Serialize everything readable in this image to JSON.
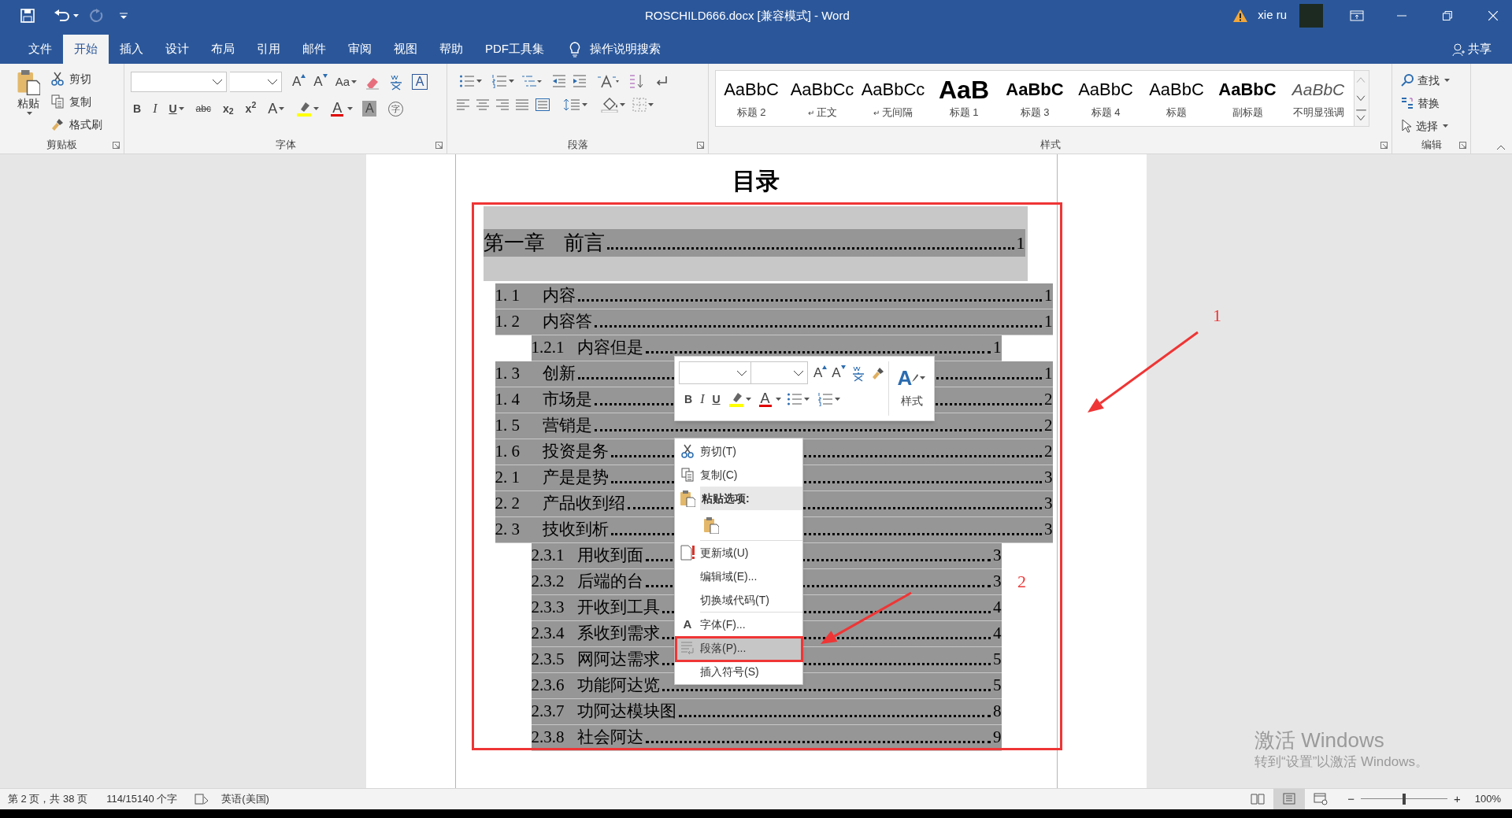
{
  "window": {
    "title": "ROSCHILD666.docx [兼容模式]  -  Word",
    "user": "xie ru"
  },
  "tabs": [
    {
      "label": "文件",
      "selected": false
    },
    {
      "label": "开始",
      "selected": true
    },
    {
      "label": "插入",
      "selected": false
    },
    {
      "label": "设计",
      "selected": false
    },
    {
      "label": "布局",
      "selected": false
    },
    {
      "label": "引用",
      "selected": false
    },
    {
      "label": "邮件",
      "selected": false
    },
    {
      "label": "审阅",
      "selected": false
    },
    {
      "label": "视图",
      "selected": false
    },
    {
      "label": "帮助",
      "selected": false
    },
    {
      "label": "PDF工具集",
      "selected": false
    }
  ],
  "tell_me": "操作说明搜索",
  "share": "共享",
  "clipboard": {
    "group": "剪贴板",
    "paste": "粘贴",
    "items": [
      "剪切",
      "复制",
      "格式刷"
    ]
  },
  "font": {
    "group": "字体",
    "row1": [
      {
        "kind": "grow",
        "glyph": "A"
      },
      {
        "kind": "shrink",
        "glyph": "A"
      },
      {
        "kind": "case",
        "glyph": "Aa"
      },
      {
        "kind": "clear"
      },
      {
        "kind": "phonetic"
      },
      {
        "kind": "border",
        "glyph": "A"
      }
    ],
    "row2": [
      {
        "kind": "bold",
        "glyph": "B"
      },
      {
        "kind": "italic",
        "glyph": "I"
      },
      {
        "kind": "underline",
        "glyph": "U"
      },
      {
        "kind": "strike",
        "glyph": "abc"
      },
      {
        "kind": "script",
        "glyph": "x$_{2}$"
      },
      {
        "kind": "script",
        "glyph": "x$^{2}$"
      },
      {
        "kind": "effects",
        "glyph": "A"
      },
      {
        "kind": "highlight"
      },
      {
        "kind": "color",
        "glyph": "A"
      },
      {
        "kind": "shading",
        "glyph": "A"
      },
      {
        "kind": "enclosed",
        "glyph": "字"
      }
    ]
  },
  "paragraph": {
    "group": "段落"
  },
  "styles": {
    "group": "样式",
    "items": [
      {
        "preview": "AaBbC",
        "label": "标题 2",
        "kind": "plain"
      },
      {
        "preview": "AaBbCc",
        "label": "正文",
        "mark": "↵",
        "kind": "plain"
      },
      {
        "preview": "AaBbCc",
        "label": "无间隔",
        "mark": "↵",
        "kind": "plain"
      },
      {
        "preview": "AaB",
        "label": "标题 1",
        "kind": "large"
      },
      {
        "preview": "AaBbC",
        "label": "标题 3",
        "kind": "bold"
      },
      {
        "preview": "AaBbC",
        "label": "标题 4",
        "kind": "plain"
      },
      {
        "preview": "AaBbC",
        "label": "标题",
        "kind": "plain"
      },
      {
        "preview": "AaBbC",
        "label": "副标题",
        "kind": "bold"
      },
      {
        "preview": "AaBbC",
        "label": "不明显强调",
        "kind": "italic"
      }
    ]
  },
  "editing": {
    "group": "编辑",
    "items": [
      "查找",
      "替换",
      "选择"
    ]
  },
  "document": {
    "title": "目录",
    "toc": [
      {
        "number": "第一章",
        "text": "前言",
        "page": "1",
        "children": [
          {
            "number": "1. 1",
            "text": "内容",
            "page": "1"
          },
          {
            "number": "1. 2",
            "text": "内容答",
            "page": "1",
            "children": [
              {
                "number": "1.2.1",
                "text": "内容但是",
                "page": "1"
              }
            ]
          },
          {
            "number": "1. 3",
            "text": "创新",
            "page": "1"
          },
          {
            "number": "1. 4",
            "text": "市场是",
            "page": "2"
          },
          {
            "number": "1. 5",
            "text": "营销是",
            "page": "2"
          },
          {
            "number": "1. 6",
            "text": "投资是务",
            "page": "2"
          },
          {
            "number": "2. 1",
            "text": "产是是势",
            "page": "3"
          },
          {
            "number": "2. 2",
            "text": "产品收到绍",
            "page": "3"
          },
          {
            "number": "2. 3",
            "text": "技收到析",
            "page": "3",
            "children": [
              {
                "number": "2.3.1",
                "text": "用收到面",
                "page": "3"
              },
              {
                "number": "2.3.2",
                "text": "后端的台",
                "page": "3"
              },
              {
                "number": "2.3.3",
                "text": "开收到工具",
                "page": "4"
              },
              {
                "number": "2.3.4",
                "text": "系收到需求",
                "page": "4"
              },
              {
                "number": "2.3.5",
                "text": "网阿达需求",
                "page": "5"
              },
              {
                "number": "2.3.6",
                "text": "功能阿达览",
                "page": "5"
              },
              {
                "number": "2.3.7",
                "text": "功阿达模块图",
                "page": "8"
              },
              {
                "number": "2.3.8",
                "text": "社会阿达",
                "page": "9"
              }
            ]
          }
        ]
      }
    ]
  },
  "mini_toolbar": {
    "row1": [
      {
        "kind": "grow",
        "glyph": "A"
      },
      {
        "kind": "shrink",
        "glyph": "A"
      },
      {
        "kind": "phonetic"
      },
      {
        "kind": "painter"
      }
    ],
    "row2": [
      {
        "kind": "bold",
        "glyph": "B"
      },
      {
        "kind": "italic",
        "glyph": "I"
      },
      {
        "kind": "underline",
        "glyph": "U"
      },
      {
        "kind": "highlight"
      },
      {
        "kind": "color",
        "glyph": "A"
      },
      {
        "kind": "bullets"
      },
      {
        "kind": "numbering"
      }
    ],
    "styles_glyph": "A",
    "styles": "样式"
  },
  "context_menu": [
    {
      "kind": "cut",
      "label": "剪切(T)",
      "selected": false
    },
    {
      "kind": "copy",
      "label": "复制(C)",
      "selected": false
    },
    {
      "kind": "header",
      "label": "粘贴选项:"
    },
    {
      "kind": "paste"
    },
    {
      "kind": "separator"
    },
    {
      "kind": "update",
      "label": "更新域(U)",
      "selected": false
    },
    {
      "kind": "item",
      "label": "编辑域(E)...",
      "selected": false
    },
    {
      "kind": "item",
      "label": "切换域代码(T)",
      "selected": false
    },
    {
      "kind": "separator"
    },
    {
      "kind": "font",
      "glyph": "A",
      "label": "字体(F)...",
      "selected": false
    },
    {
      "kind": "paragraph",
      "label": "段落(P)...",
      "selected": true
    },
    {
      "kind": "item",
      "label": "插入符号(S)",
      "selected": false
    }
  ],
  "annotations": [
    {
      "kind": "frame"
    },
    {
      "kind": "frame"
    },
    {
      "kind": "arrow",
      "label": "1"
    },
    {
      "kind": "arrow",
      "label": "2"
    }
  ],
  "activation_notice": {
    "title": "激活 Windows",
    "text": "转到“设置”以激活 Windows。"
  },
  "status_bar": {
    "page": "第 2 页，共 38 页",
    "words": "114/15140 个字",
    "language": "英语(美国)",
    "views": [
      {
        "kind": "read",
        "selected": false
      },
      {
        "kind": "print",
        "selected": true
      },
      {
        "kind": "web",
        "selected": false
      }
    ],
    "zoom": {
      "minus": "−",
      "plus": "+",
      "level": 0.5,
      "reading": "100%"
    }
  }
}
